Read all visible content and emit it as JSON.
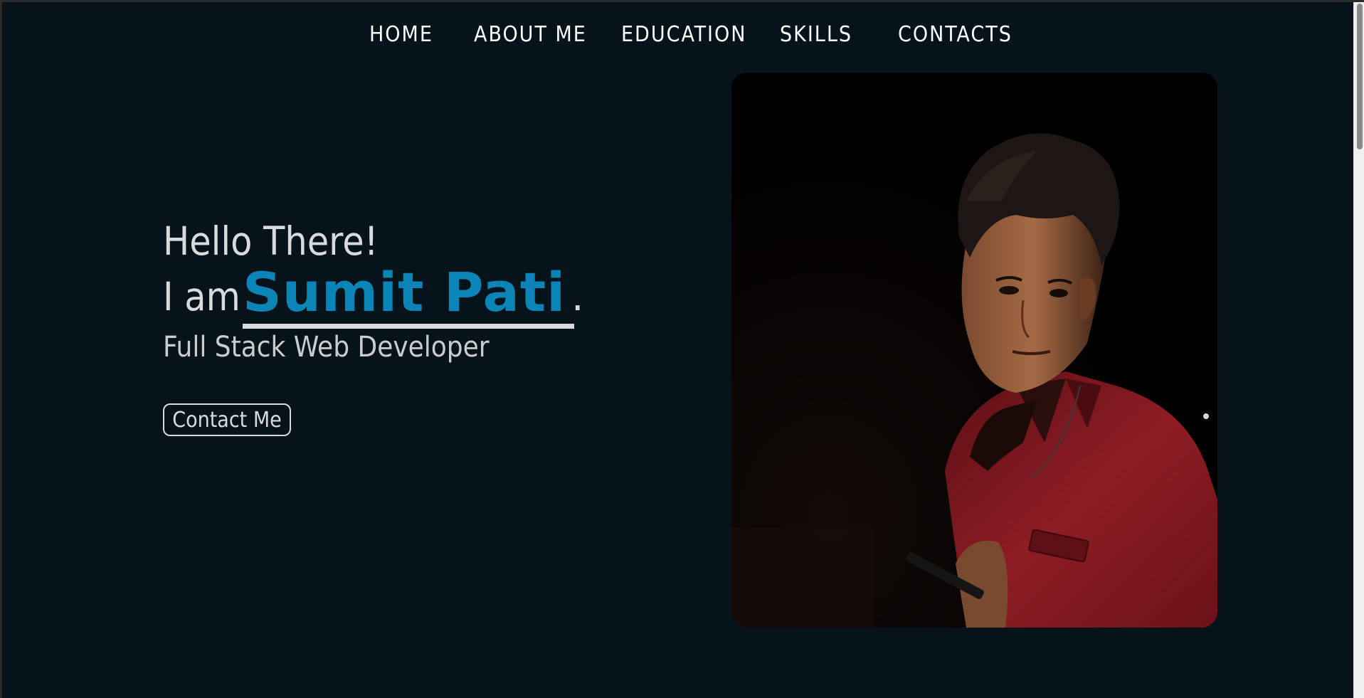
{
  "nav": {
    "items": [
      {
        "label": "HOME"
      },
      {
        "label": "ABOUT ME"
      },
      {
        "label": "EDUCATION"
      },
      {
        "label": "SKILLS"
      },
      {
        "label": "CONTACTS"
      }
    ]
  },
  "hero": {
    "greeting": "Hello There!",
    "intro": "I am",
    "name": "Sumit Pati",
    "punctuation": ".",
    "role": "Full Stack Web Developer",
    "cta_label": "Contact Me"
  },
  "colors": {
    "background": "#06131a",
    "accent": "#0b84b8",
    "text": "#d9dadb"
  }
}
